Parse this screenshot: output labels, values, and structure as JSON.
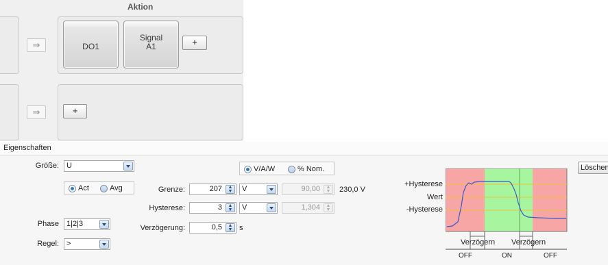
{
  "top": {
    "action_header": "Aktion",
    "row1": {
      "arrow": "⇒",
      "btn1_label": "DO1",
      "btn2_line1": "Signal",
      "btn2_line2": "A1",
      "add_label": "+"
    },
    "row2": {
      "arrow": "⇒",
      "add_label": "+"
    }
  },
  "section_title": "Eigenschaften",
  "props": {
    "groesse_label": "Größe:",
    "groesse_value": "U",
    "act_label": "Act",
    "avg_label": "Avg",
    "phase_label": "Phase",
    "phase_value": "1|2|3",
    "regel_label": "Regel:",
    "regel_value": ">",
    "unit_radio1": "V/A/W",
    "unit_radio2": "% Nom.",
    "grenze_label": "Grenze:",
    "grenze_value": "207",
    "grenze_unit": "V",
    "grenze_percent": "90,00",
    "grenze_nominal": "230,0 V",
    "hysterese_label": "Hysterese:",
    "hysterese_value": "3",
    "hysterese_unit": "V",
    "hysterese_percent": "1,304",
    "verzoegerung_label": "Verzögerung:",
    "verzoegerung_value": "0,5",
    "verzoegerung_unit": "s",
    "delete_label": "Löschen"
  },
  "diagram": {
    "label_hyst_plus": "+Hysterese",
    "label_wert": "Wert",
    "label_hyst_minus": "-Hysterese",
    "delay1": "Verzögern",
    "delay2": "Verzögern",
    "state_off1": "OFF",
    "state_on": "ON",
    "state_off2": "OFF",
    "colors": {
      "off": "#f7a5a5",
      "on": "#a8f5a0",
      "threshold": "#e8c23a",
      "signal": "#3a58c8"
    }
  }
}
